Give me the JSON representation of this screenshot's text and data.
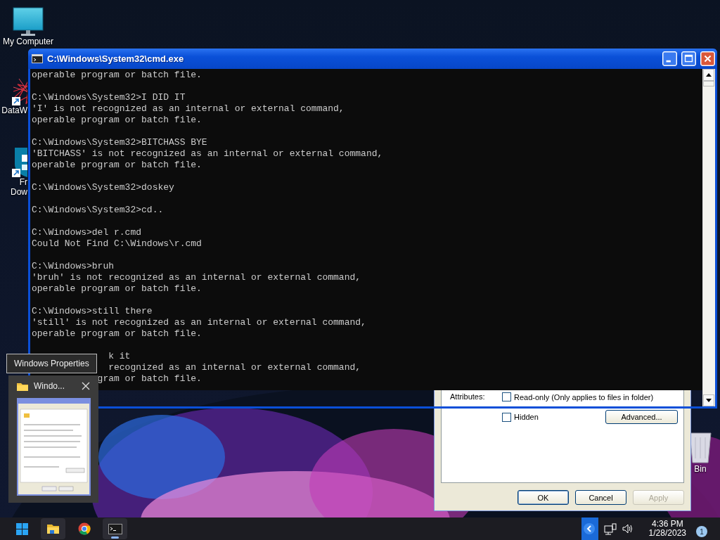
{
  "desktop_icons": [
    {
      "kind": "monitor",
      "lines": [
        "My Computer"
      ]
    },
    {
      "kind": "scribble",
      "lines": [
        "DataW"
      ]
    },
    {
      "kind": "shield",
      "lines": [
        "Fr",
        "Dow"
      ]
    },
    {
      "kind": "bin",
      "lines": [
        "Bin"
      ]
    }
  ],
  "properties_dialog": {
    "attributes_label": "Attributes:",
    "checkboxes": [
      {
        "label": "Read-only (Only applies to files in folder)",
        "checked": false
      },
      {
        "label": "Hidden",
        "checked": false
      }
    ],
    "advanced_button": "Advanced...",
    "buttons": [
      {
        "label": "OK",
        "default": true,
        "disabled": false
      },
      {
        "label": "Cancel",
        "default": false,
        "disabled": false
      },
      {
        "label": "Apply",
        "default": false,
        "disabled": true
      }
    ]
  },
  "cmd_window": {
    "title": "C:\\Windows\\System32\\cmd.exe",
    "blocks": [
      [
        "operable program or batch file."
      ],
      [
        "C:\\Windows\\System32>I DID IT",
        "'I' is not recognized as an internal or external command,",
        "operable program or batch file."
      ],
      [
        "C:\\Windows\\System32>BITCHASS BYE",
        "'BITCHASS' is not recognized as an internal or external command,",
        "operable program or batch file."
      ],
      [
        "C:\\Windows\\System32>doskey"
      ],
      [
        "C:\\Windows\\System32>cd.."
      ],
      [
        "C:\\Windows>del r.cmd",
        "Could Not Find C:\\Windows\\r.cmd"
      ],
      [
        "C:\\Windows>bruh",
        "'bruh' is not recognized as an internal or external command,",
        "operable program or batch file."
      ],
      [
        "C:\\Windows>still there",
        "'still' is not recognized as an internal or external command,",
        "operable program or batch file."
      ],
      [
        "              k it",
        "              recognized as an internal or external command,",
        "            gram or batch file."
      ]
    ]
  },
  "thumbnail_popup": {
    "tooltip": "Windows Properties",
    "title": "Windo..."
  },
  "taskbar": {
    "apps": [
      {
        "kind": "start",
        "highlighted": false,
        "active": false
      },
      {
        "kind": "explorer",
        "highlighted": true,
        "active": false
      },
      {
        "kind": "chrome",
        "highlighted": false,
        "active": false
      },
      {
        "kind": "terminal",
        "highlighted": true,
        "active": true
      }
    ],
    "time": "4:36 PM",
    "date": "1/28/2023",
    "badge": "1"
  }
}
